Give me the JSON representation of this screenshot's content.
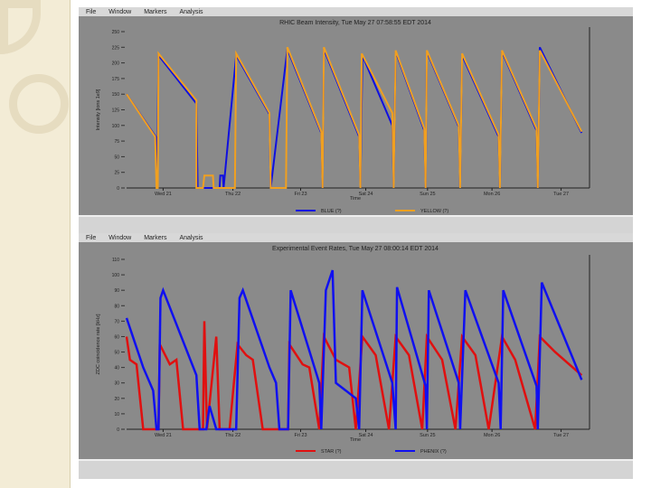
{
  "menu": [
    "File",
    "Window",
    "Markers",
    "Analysis"
  ],
  "chart_data": [
    {
      "type": "line",
      "title": "RHIC Beam Intensity, Tue May 27 07:58:55 EDT 2014",
      "xlabel": "Time",
      "ylabel": "Intensity [ions 1e9]",
      "xlim": [
        20.45,
        27.35
      ],
      "ylim": [
        0,
        250
      ],
      "yticks": [
        0,
        25,
        50,
        75,
        100,
        125,
        150,
        175,
        200,
        225,
        250
      ],
      "xticks": [
        {
          "v": 21,
          "label": "Wed 21"
        },
        {
          "v": 22.05,
          "label": "Thu 22"
        },
        {
          "v": 23.07,
          "label": "Fri 23"
        },
        {
          "v": 24.05,
          "label": "Sat 24"
        },
        {
          "v": 24.98,
          "label": "Sun 25"
        },
        {
          "v": 25.95,
          "label": "Mon 26"
        },
        {
          "v": 26.99,
          "label": "Tue 27"
        }
      ],
      "legend": "bottom",
      "series": [
        {
          "name": "BLUE (?)",
          "color": "#1010e0",
          "points": [
            [
              20.45,
              150
            ],
            [
              20.9,
              80
            ],
            [
              20.91,
              0
            ],
            [
              20.93,
              212
            ],
            [
              21.5,
              135
            ],
            [
              21.52,
              0
            ],
            [
              21.85,
              0
            ],
            [
              21.86,
              20
            ],
            [
              21.9,
              20
            ],
            [
              21.91,
              0
            ],
            [
              22.1,
              212
            ],
            [
              22.6,
              118
            ],
            [
              22.62,
              0
            ],
            [
              22.87,
              222
            ],
            [
              23.38,
              88
            ],
            [
              23.4,
              0
            ],
            [
              23.42,
              222
            ],
            [
              23.95,
              82
            ],
            [
              23.97,
              0
            ],
            [
              24.0,
              212
            ],
            [
              24.45,
              100
            ],
            [
              24.47,
              0
            ],
            [
              24.5,
              218
            ],
            [
              24.93,
              92
            ],
            [
              24.95,
              0
            ],
            [
              24.97,
              218
            ],
            [
              25.45,
              98
            ],
            [
              25.47,
              0
            ],
            [
              25.5,
              212
            ],
            [
              26.05,
              82
            ],
            [
              26.07,
              0
            ],
            [
              26.1,
              218
            ],
            [
              26.62,
              92
            ],
            [
              26.64,
              0
            ],
            [
              26.67,
              225
            ],
            [
              27.3,
              88
            ]
          ]
        },
        {
          "name": "YELLOW (?)",
          "color": "#f0a020",
          "points": [
            [
              20.45,
              150
            ],
            [
              20.88,
              82
            ],
            [
              20.9,
              0
            ],
            [
              20.92,
              0
            ],
            [
              20.93,
              215
            ],
            [
              21.5,
              140
            ],
            [
              21.5,
              0
            ],
            [
              21.6,
              0
            ],
            [
              21.62,
              20
            ],
            [
              21.75,
              20
            ],
            [
              21.76,
              0
            ],
            [
              22.08,
              0
            ],
            [
              22.1,
              215
            ],
            [
              22.6,
              120
            ],
            [
              22.62,
              0
            ],
            [
              22.85,
              0
            ],
            [
              22.87,
              225
            ],
            [
              23.38,
              90
            ],
            [
              23.4,
              0
            ],
            [
              23.42,
              225
            ],
            [
              23.95,
              85
            ],
            [
              23.97,
              0
            ],
            [
              23.99,
              215
            ],
            [
              24.45,
              120
            ],
            [
              24.47,
              0
            ],
            [
              24.5,
              220
            ],
            [
              24.93,
              95
            ],
            [
              24.95,
              0
            ],
            [
              24.97,
              220
            ],
            [
              25.45,
              100
            ],
            [
              25.47,
              0
            ],
            [
              25.5,
              215
            ],
            [
              26.05,
              85
            ],
            [
              26.07,
              0
            ],
            [
              26.1,
              220
            ],
            [
              26.62,
              95
            ],
            [
              26.64,
              0
            ],
            [
              26.67,
              220
            ],
            [
              27.3,
              90
            ]
          ]
        }
      ]
    },
    {
      "type": "line",
      "title": "Experimental Event Rates, Tue May 27 08:00:14 EDT 2014",
      "xlabel": "Time",
      "ylabel": "ZDC coincidence rate [kHz]",
      "xlim": [
        20.45,
        27.35
      ],
      "ylim": [
        0,
        110
      ],
      "yticks": [
        0,
        10,
        20,
        30,
        40,
        50,
        60,
        70,
        80,
        90,
        100,
        110
      ],
      "xticks": [
        {
          "v": 21,
          "label": "Wed 21"
        },
        {
          "v": 22.05,
          "label": "Thu 22"
        },
        {
          "v": 23.07,
          "label": "Fri 23"
        },
        {
          "v": 24.05,
          "label": "Sat 24"
        },
        {
          "v": 24.98,
          "label": "Sun 25"
        },
        {
          "v": 25.95,
          "label": "Mon 26"
        },
        {
          "v": 26.99,
          "label": "Tue 27"
        }
      ],
      "legend": "bottom",
      "series": [
        {
          "name": "STAR (?)",
          "color": "#e01010",
          "points": [
            [
              20.45,
              60
            ],
            [
              20.5,
              45
            ],
            [
              20.6,
              42
            ],
            [
              20.7,
              0
            ],
            [
              20.93,
              0
            ],
            [
              20.95,
              55
            ],
            [
              21.1,
              42
            ],
            [
              21.2,
              45
            ],
            [
              21.3,
              0
            ],
            [
              21.6,
              0
            ],
            [
              21.62,
              70
            ],
            [
              21.66,
              0
            ],
            [
              21.8,
              60
            ],
            [
              21.85,
              0
            ],
            [
              22.0,
              0
            ],
            [
              22.12,
              55
            ],
            [
              22.25,
              48
            ],
            [
              22.35,
              45
            ],
            [
              22.5,
              0
            ],
            [
              22.88,
              0
            ],
            [
              22.9,
              55
            ],
            [
              23.1,
              42
            ],
            [
              23.2,
              40
            ],
            [
              23.35,
              0
            ],
            [
              23.42,
              60
            ],
            [
              23.6,
              45
            ],
            [
              23.8,
              40
            ],
            [
              23.9,
              0
            ],
            [
              24.0,
              60
            ],
            [
              24.2,
              48
            ],
            [
              24.4,
              0
            ],
            [
              24.5,
              60
            ],
            [
              24.7,
              48
            ],
            [
              24.9,
              0
            ],
            [
              24.97,
              60
            ],
            [
              25.2,
              45
            ],
            [
              25.4,
              0
            ],
            [
              25.5,
              60
            ],
            [
              25.7,
              48
            ],
            [
              25.9,
              0
            ],
            [
              26.1,
              60
            ],
            [
              26.3,
              45
            ],
            [
              26.6,
              0
            ],
            [
              26.67,
              60
            ],
            [
              26.9,
              50
            ],
            [
              27.3,
              35
            ]
          ]
        },
        {
          "name": "PHENIX (?)",
          "color": "#1010f0",
          "points": [
            [
              20.45,
              72
            ],
            [
              20.7,
              40
            ],
            [
              20.85,
              25
            ],
            [
              20.9,
              0
            ],
            [
              20.93,
              0
            ],
            [
              20.96,
              85
            ],
            [
              21.0,
              90
            ],
            [
              21.5,
              35
            ],
            [
              21.55,
              0
            ],
            [
              21.65,
              0
            ],
            [
              21.7,
              15
            ],
            [
              21.8,
              0
            ],
            [
              22.1,
              0
            ],
            [
              22.15,
              85
            ],
            [
              22.2,
              90
            ],
            [
              22.6,
              40
            ],
            [
              22.7,
              30
            ],
            [
              22.75,
              0
            ],
            [
              22.88,
              0
            ],
            [
              22.92,
              90
            ],
            [
              23.35,
              30
            ],
            [
              23.38,
              0
            ],
            [
              23.45,
              90
            ],
            [
              23.55,
              103
            ],
            [
              23.6,
              30
            ],
            [
              23.9,
              20
            ],
            [
              23.95,
              0
            ],
            [
              24.0,
              90
            ],
            [
              24.45,
              30
            ],
            [
              24.5,
              0
            ],
            [
              24.52,
              92
            ],
            [
              24.95,
              28
            ],
            [
              24.97,
              0
            ],
            [
              25.0,
              90
            ],
            [
              25.45,
              30
            ],
            [
              25.47,
              0
            ],
            [
              25.55,
              90
            ],
            [
              26.05,
              30
            ],
            [
              26.08,
              0
            ],
            [
              26.12,
              90
            ],
            [
              26.62,
              28
            ],
            [
              26.64,
              0
            ],
            [
              26.7,
              95
            ],
            [
              27.3,
              32
            ]
          ]
        }
      ]
    }
  ]
}
